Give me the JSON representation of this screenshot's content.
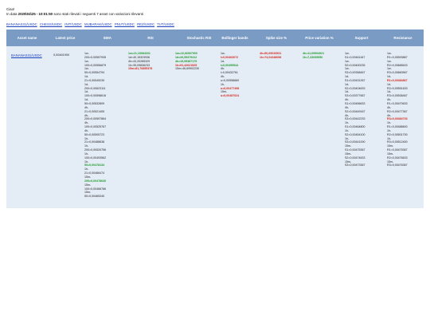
{
  "greeting": "Ciao!",
  "intro": {
    "prefix": "In data ",
    "datetime": "2025\\04\\25 - 10:01:50",
    "suffix": " sono stati rilevati i seguenti 7 asset con variazioni rilevanti"
  },
  "asset_links": [
    "BANANAS31/USDC",
    "CHESS/USDC",
    "INIT/USDC",
    "MUBARAK/USDC",
    "PNUT/USDC",
    "REZ/USDC",
    "TUT/USDC"
  ],
  "table": {
    "headers": [
      "Asset name",
      "Latest price",
      "EMA",
      "RSI",
      "Stochastic RSI",
      "Bollinger bands",
      "Spike size %",
      "Price variation %",
      "Support",
      "Resistance"
    ],
    "row": {
      "asset": "BANANAS31/USDC",
      "latest_price": "0,00461900",
      "ema": [
        {
          "t": "1w-",
          "c": ""
        },
        {
          "t": "200=0,00557935",
          "c": ""
        },
        {
          "t": "1w-",
          "c": ""
        },
        {
          "t": "100=0,00556879",
          "c": ""
        },
        {
          "t": "1w-",
          "c": ""
        },
        {
          "t": "50=0,00554794",
          "c": ""
        },
        {
          "t": "1d-",
          "c": ""
        },
        {
          "t": "21=0,00549239",
          "c": ""
        },
        {
          "t": "1d-",
          "c": ""
        },
        {
          "t": "200=0,00623111",
          "c": ""
        },
        {
          "t": "1d-",
          "c": ""
        },
        {
          "t": "100=0,00598616",
          "c": ""
        },
        {
          "t": "1d-",
          "c": ""
        },
        {
          "t": "50=0,00532809",
          "c": ""
        },
        {
          "t": "4h-",
          "c": ""
        },
        {
          "t": "21=0,00521405",
          "c": ""
        },
        {
          "t": "4h-",
          "c": ""
        },
        {
          "t": "200=0,00597864",
          "c": ""
        },
        {
          "t": "4h-",
          "c": ""
        },
        {
          "t": "100=0,00525767",
          "c": ""
        },
        {
          "t": "4h-",
          "c": ""
        },
        {
          "t": "50=0,00505723",
          "c": ""
        },
        {
          "t": "1h-",
          "c": ""
        },
        {
          "t": "21=0,00488638",
          "c": ""
        },
        {
          "t": "1h-",
          "c": ""
        },
        {
          "t": "200=0,00520756",
          "c": ""
        },
        {
          "t": "1h-",
          "c": ""
        },
        {
          "t": "100=0,00493562",
          "c": ""
        },
        {
          "t": "1h-",
          "c": ""
        },
        {
          "t": "50=0,00478134",
          "c": "g"
        },
        {
          "t": "1h-",
          "c": ""
        },
        {
          "t": "21=0,00466474",
          "c": ""
        },
        {
          "t": "15m-",
          "c": ""
        },
        {
          "t": "200=0,00478640",
          "c": "g"
        },
        {
          "t": "15m-",
          "c": ""
        },
        {
          "t": "100=0,00466786",
          "c": ""
        },
        {
          "t": "15m-",
          "c": ""
        },
        {
          "t": "50=0,00465340",
          "c": ""
        }
      ],
      "rsi": [
        {
          "t": "1w=21,15084331",
          "c": "g"
        },
        {
          "t": "1d=40,15323936",
          "c": ""
        },
        {
          "t": "4h=43,20285329",
          "c": ""
        },
        {
          "t": "1h=35,09836233",
          "c": ""
        },
        {
          "t": "15m=81,76855378",
          "c": "r"
        }
      ],
      "stoch": [
        {
          "t": "1w=16,66507900",
          "c": "g"
        },
        {
          "t": "1d=26,55379412",
          "c": "g"
        },
        {
          "t": "4h=15,95387179",
          "c": "g"
        },
        {
          "t": "1h=91,42621525",
          "c": "r"
        },
        {
          "t": "15m=46,69902230",
          "c": ""
        }
      ],
      "bollinger": [
        {
          "t": "1w-",
          "c": ""
        },
        {
          "t": "l=0,00463072",
          "c": "r"
        },
        {
          "t": "1d-",
          "c": ""
        },
        {
          "t": "l=0,00459544",
          "c": "g"
        },
        {
          "t": "4h-",
          "c": ""
        },
        {
          "t": "l=0,00432761",
          "c": ""
        },
        {
          "t": "4h-",
          "c": ""
        },
        {
          "t": "u=0,00558669",
          "c": ""
        },
        {
          "t": "1h-",
          "c": ""
        },
        {
          "t": "u=0,00477498",
          "c": "r"
        },
        {
          "t": "15m-",
          "c": ""
        },
        {
          "t": "u=0,00487624",
          "c": "r"
        }
      ],
      "spike": [
        {
          "t": "4h=50,69033531",
          "c": "r"
        },
        {
          "t": "1h=74,04348058",
          "c": "r"
        }
      ],
      "price_variation": [
        {
          "t": "4h=11,69994921",
          "c": "g"
        },
        {
          "t": "1h=7,33935550",
          "c": "g"
        }
      ],
      "support": [
        {
          "t": "1w-",
          "c": ""
        },
        {
          "t": "S1=0,00461167",
          "c": ""
        },
        {
          "t": "1w-",
          "c": ""
        },
        {
          "t": "S2=0,00400235",
          "c": ""
        },
        {
          "t": "1w-",
          "c": ""
        },
        {
          "t": "S3=0,00358467",
          "c": ""
        },
        {
          "t": "1d-",
          "c": ""
        },
        {
          "t": "S1=0,00431267",
          "c": ""
        },
        {
          "t": "1d-",
          "c": ""
        },
        {
          "t": "S2=0,00404633",
          "c": ""
        },
        {
          "t": "1d-",
          "c": ""
        },
        {
          "t": "S3=0,00377667",
          "c": ""
        },
        {
          "t": "4h-",
          "c": ""
        },
        {
          "t": "S1=0,00456633",
          "c": ""
        },
        {
          "t": "4h-",
          "c": ""
        },
        {
          "t": "S2=0,00449167",
          "c": ""
        },
        {
          "t": "4h-",
          "c": ""
        },
        {
          "t": "S3=0,00442233",
          "c": ""
        },
        {
          "t": "1h-",
          "c": ""
        },
        {
          "t": "S1=0,00464800",
          "c": ""
        },
        {
          "t": "1h-",
          "c": ""
        },
        {
          "t": "S2=0,00454100",
          "c": ""
        },
        {
          "t": "1h-",
          "c": ""
        },
        {
          "t": "S3=0,00441000",
          "c": ""
        },
        {
          "t": "15m-",
          "c": ""
        },
        {
          "t": "S1=0,00475367",
          "c": ""
        },
        {
          "t": "15m-",
          "c": ""
        },
        {
          "t": "S2=0,00474633",
          "c": ""
        },
        {
          "t": "15m-",
          "c": ""
        },
        {
          "t": "S3=0,00473367",
          "c": ""
        }
      ],
      "resistance": [
        {
          "t": "1w-",
          "c": ""
        },
        {
          "t": "R1=0,00593867",
          "c": ""
        },
        {
          "t": "1w-",
          "c": ""
        },
        {
          "t": "R2=0,00685633",
          "c": ""
        },
        {
          "t": "1w-",
          "c": ""
        },
        {
          "t": "R3=0,00660567",
          "c": ""
        },
        {
          "t": "1d-",
          "c": ""
        },
        {
          "t": "R1=0,00484867",
          "c": "r"
        },
        {
          "t": "1d-",
          "c": ""
        },
        {
          "t": "R2=0,00551633",
          "c": ""
        },
        {
          "t": "1d-",
          "c": ""
        },
        {
          "t": "R3=0,00538467",
          "c": ""
        },
        {
          "t": "4h-",
          "c": ""
        },
        {
          "t": "R1=0,00470633",
          "c": ""
        },
        {
          "t": "4h-",
          "c": ""
        },
        {
          "t": "R2=0,00477367",
          "c": ""
        },
        {
          "t": "4h-",
          "c": ""
        },
        {
          "t": "R3=0,00484733",
          "c": "r"
        },
        {
          "t": "1h-",
          "c": ""
        },
        {
          "t": "R1=0,00488600",
          "c": ""
        },
        {
          "t": "1h-",
          "c": ""
        },
        {
          "t": "R2=0,00501700",
          "c": ""
        },
        {
          "t": "1h-",
          "c": ""
        },
        {
          "t": "R3=0,00512400",
          "c": ""
        },
        {
          "t": "15m-",
          "c": ""
        },
        {
          "t": "R1=0,00475367",
          "c": ""
        },
        {
          "t": "15m-",
          "c": ""
        },
        {
          "t": "R2=0,00476633",
          "c": ""
        },
        {
          "t": "15m-",
          "c": ""
        },
        {
          "t": "R3=0,00476367",
          "c": ""
        }
      ]
    }
  },
  "colors": {
    "header_bg": "#7a9bc4",
    "row_bg": "#e4ecf5",
    "positive": "#1e9a2c",
    "negative": "#d42a1e",
    "link": "#1a3fbf"
  }
}
